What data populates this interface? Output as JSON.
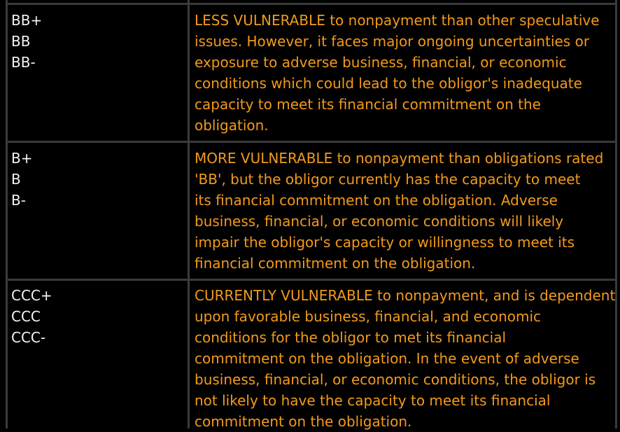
{
  "rows": [
    {
      "ratings": [
        "BB+",
        "BB",
        "BB-"
      ],
      "lines": [
        "LESS VULNERABLE to nonpayment than other speculative",
        "issues. However, it faces major ongoing uncertainties or",
        "exposure to adverse business, financial, or economic",
        "conditions which could lead to the obligor's inadequate",
        "capacity to meet its financial commitment on the",
        "obligation."
      ]
    },
    {
      "ratings": [
        "B+",
        "B",
        "B-"
      ],
      "lines": [
        "MORE VULNERABLE to nonpayment than obligations rated",
        "'BB', but the obligor currently has the capacity to meet",
        "its financial commitment on the obligation. Adverse",
        "business, financial, or economic conditions will likely",
        "impair the obligor's capacity or willingness to meet its",
        "financial commitment on the obligation."
      ]
    },
    {
      "ratings": [
        "CCC+",
        "CCC",
        "CCC-"
      ],
      "lines": [
        "CURRENTLY VULNERABLE to nonpayment, and is dependent",
        "upon favorable business, financial, and economic",
        "conditions for the obligor to met its financial",
        "commitment on the obligation. In the event of adverse",
        "business, financial, or economic conditions, the obligor is",
        "not likely to have the capacity to meet its financial",
        "commitment on the obligation."
      ]
    }
  ],
  "colors": {
    "background": "#000000",
    "rating_text": "#f4f4f4",
    "description_text": "#f39a1c",
    "grid": "#3a3a3a"
  }
}
